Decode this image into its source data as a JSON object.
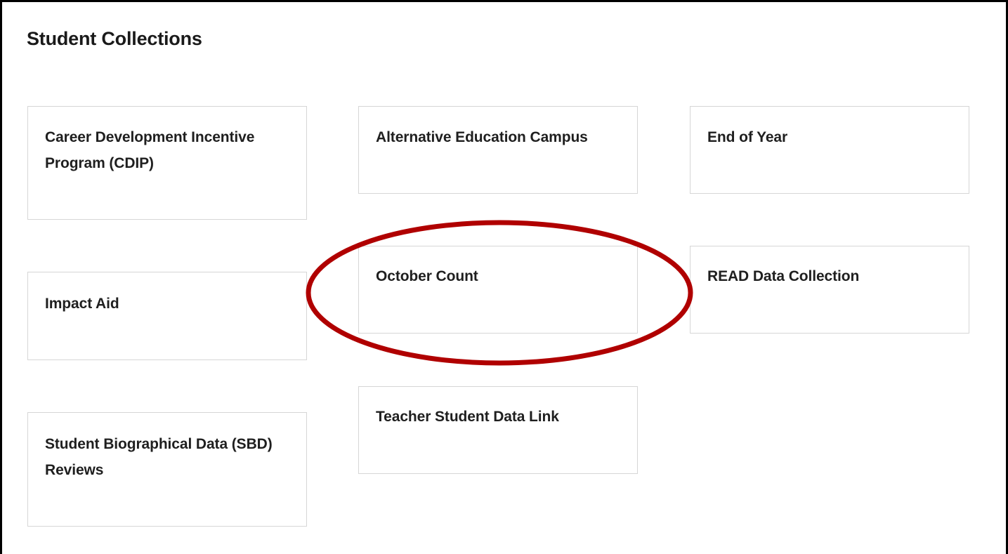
{
  "page": {
    "title": "Student Collections"
  },
  "tiles": [
    {
      "label": "Career Development Incentive Program (CDIP)"
    },
    {
      "label": "Impact Aid"
    },
    {
      "label": "Student Biographical Data (SBD) Reviews"
    },
    {
      "label": "Alternative Education Campus"
    },
    {
      "label": "October Count"
    },
    {
      "label": "Teacher Student Data Link"
    },
    {
      "label": "End of Year"
    },
    {
      "label": "READ Data Collection"
    }
  ],
  "annotation": {
    "type": "ellipse",
    "target": "October Count",
    "color": "#b00000"
  }
}
